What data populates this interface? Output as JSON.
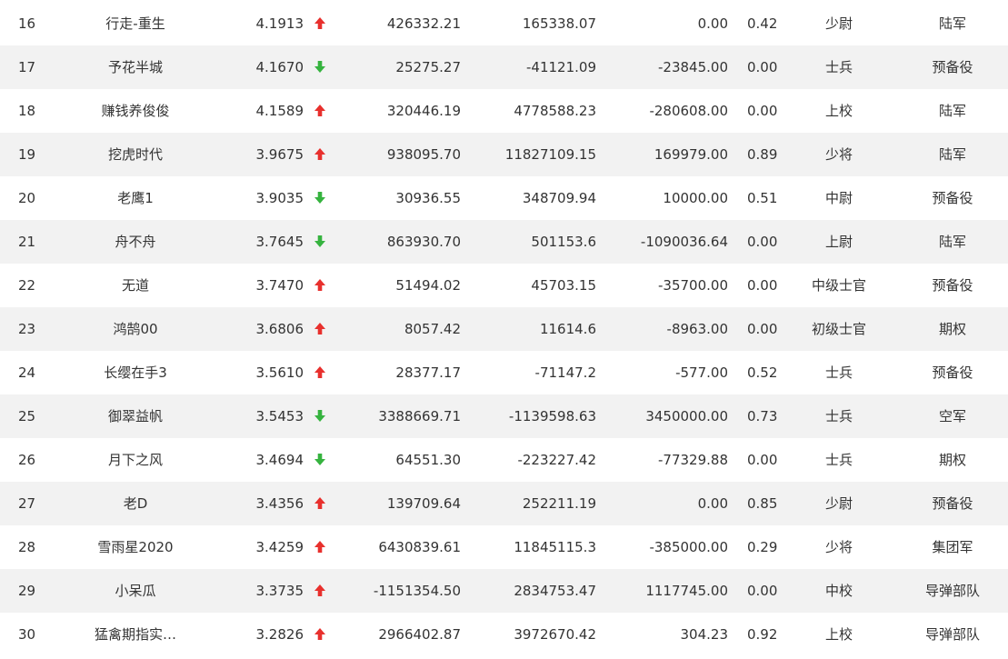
{
  "colors": {
    "up": "#e8302d",
    "down": "#36b33f",
    "text": "#333333",
    "row_alt": "#f2f2f2"
  },
  "rows": [
    {
      "rank": "16",
      "name": "行走-重生",
      "score": "4.1913",
      "trend": "up",
      "v1": "426332.21",
      "v2": "165338.07",
      "v3": "0.00",
      "ratio": "0.42",
      "military_rank": "少尉",
      "group": "陆军"
    },
    {
      "rank": "17",
      "name": "予花半城",
      "score": "4.1670",
      "trend": "down",
      "v1": "25275.27",
      "v2": "-41121.09",
      "v3": "-23845.00",
      "ratio": "0.00",
      "military_rank": "士兵",
      "group": "预备役"
    },
    {
      "rank": "18",
      "name": "赚钱养俊俊",
      "score": "4.1589",
      "trend": "up",
      "v1": "320446.19",
      "v2": "4778588.23",
      "v3": "-280608.00",
      "ratio": "0.00",
      "military_rank": "上校",
      "group": "陆军"
    },
    {
      "rank": "19",
      "name": "挖虎时代",
      "score": "3.9675",
      "trend": "up",
      "v1": "938095.70",
      "v2": "11827109.15",
      "v3": "169979.00",
      "ratio": "0.89",
      "military_rank": "少将",
      "group": "陆军"
    },
    {
      "rank": "20",
      "name": "老鹰1",
      "score": "3.9035",
      "trend": "down",
      "v1": "30936.55",
      "v2": "348709.94",
      "v3": "10000.00",
      "ratio": "0.51",
      "military_rank": "中尉",
      "group": "预备役"
    },
    {
      "rank": "21",
      "name": "舟不舟",
      "score": "3.7645",
      "trend": "down",
      "v1": "863930.70",
      "v2": "501153.6",
      "v3": "-1090036.64",
      "ratio": "0.00",
      "military_rank": "上尉",
      "group": "陆军"
    },
    {
      "rank": "22",
      "name": "无道",
      "score": "3.7470",
      "trend": "up",
      "v1": "51494.02",
      "v2": "45703.15",
      "v3": "-35700.00",
      "ratio": "0.00",
      "military_rank": "中级士官",
      "group": "预备役"
    },
    {
      "rank": "23",
      "name": "鸿鹄00",
      "score": "3.6806",
      "trend": "up",
      "v1": "8057.42",
      "v2": "11614.6",
      "v3": "-8963.00",
      "ratio": "0.00",
      "military_rank": "初级士官",
      "group": "期权"
    },
    {
      "rank": "24",
      "name": "长缨在手3",
      "score": "3.5610",
      "trend": "up",
      "v1": "28377.17",
      "v2": "-71147.2",
      "v3": "-577.00",
      "ratio": "0.52",
      "military_rank": "士兵",
      "group": "预备役"
    },
    {
      "rank": "25",
      "name": "御翠益帆",
      "score": "3.5453",
      "trend": "down",
      "v1": "3388669.71",
      "v2": "-1139598.63",
      "v3": "3450000.00",
      "ratio": "0.73",
      "military_rank": "士兵",
      "group": "空军"
    },
    {
      "rank": "26",
      "name": "月下之风",
      "score": "3.4694",
      "trend": "down",
      "v1": "64551.30",
      "v2": "-223227.42",
      "v3": "-77329.88",
      "ratio": "0.00",
      "military_rank": "士兵",
      "group": "期权"
    },
    {
      "rank": "27",
      "name": "老D",
      "score": "3.4356",
      "trend": "up",
      "v1": "139709.64",
      "v2": "252211.19",
      "v3": "0.00",
      "ratio": "0.85",
      "military_rank": "少尉",
      "group": "预备役"
    },
    {
      "rank": "28",
      "name": "雪雨星2020",
      "score": "3.4259",
      "trend": "up",
      "v1": "6430839.61",
      "v2": "11845115.3",
      "v3": "-385000.00",
      "ratio": "0.29",
      "military_rank": "少将",
      "group": "集团军"
    },
    {
      "rank": "29",
      "name": "小呆瓜",
      "score": "3.3735",
      "trend": "up",
      "v1": "-1151354.50",
      "v2": "2834753.47",
      "v3": "1117745.00",
      "ratio": "0.00",
      "military_rank": "中校",
      "group": "导弹部队"
    },
    {
      "rank": "30",
      "name": "猛禽期指实…",
      "score": "3.2826",
      "trend": "up",
      "v1": "2966402.87",
      "v2": "3972670.42",
      "v3": "304.23",
      "ratio": "0.92",
      "military_rank": "上校",
      "group": "导弹部队"
    }
  ]
}
